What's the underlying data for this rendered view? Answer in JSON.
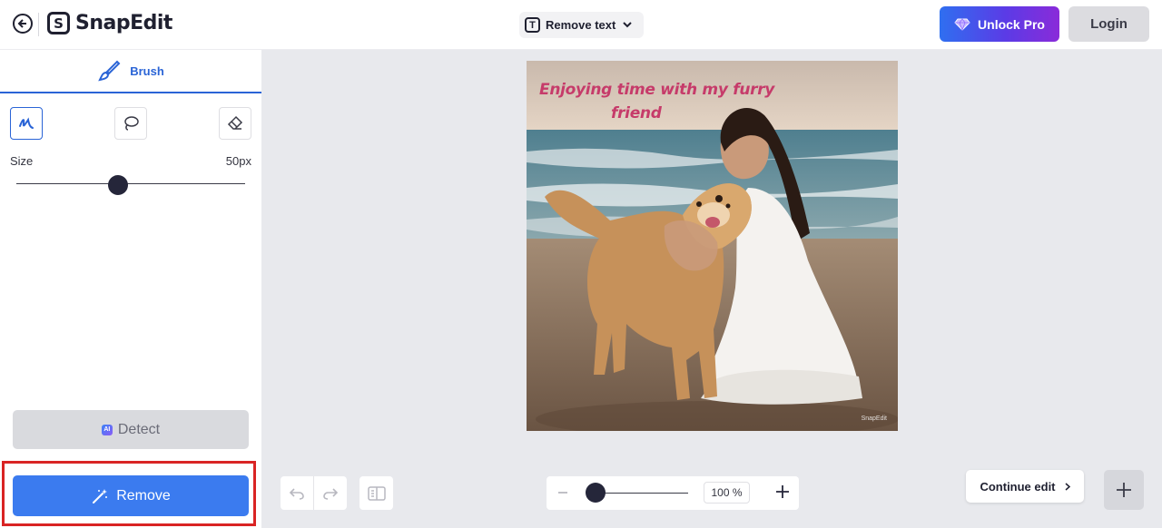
{
  "header": {
    "logo_text": "SnapEdit",
    "logo_mark": "S",
    "tool_select": {
      "icon": "T",
      "label": "Remove text"
    },
    "unlock_label": "Unlock Pro",
    "login_label": "Login"
  },
  "sidebar": {
    "tab_label": "Brush",
    "size_label": "Size",
    "size_value": "50px",
    "size_level_percent": 44,
    "detect": {
      "badge": "AI",
      "label": "Detect"
    },
    "remove_label": "Remove"
  },
  "canvas": {
    "caption_line1": "Enjoying time with my furry",
    "caption_line2": "friend",
    "watermark": "SnapEdit",
    "zoom_value": "100 %",
    "continue_label": "Continue edit"
  },
  "colors": {
    "accent": "#2a64d6",
    "remove_button": "#3b7bef",
    "highlight": "#d92424",
    "caption": "#c63b6a"
  },
  "icons": [
    "back-arrow-icon",
    "text-icon",
    "chevron-down-icon",
    "diamond-icon",
    "brush-icon",
    "lasso-icon",
    "eraser-icon",
    "magic-wand-icon",
    "undo-icon",
    "redo-icon",
    "compare-icon",
    "minus-icon",
    "plus-icon",
    "chevron-right-icon"
  ]
}
